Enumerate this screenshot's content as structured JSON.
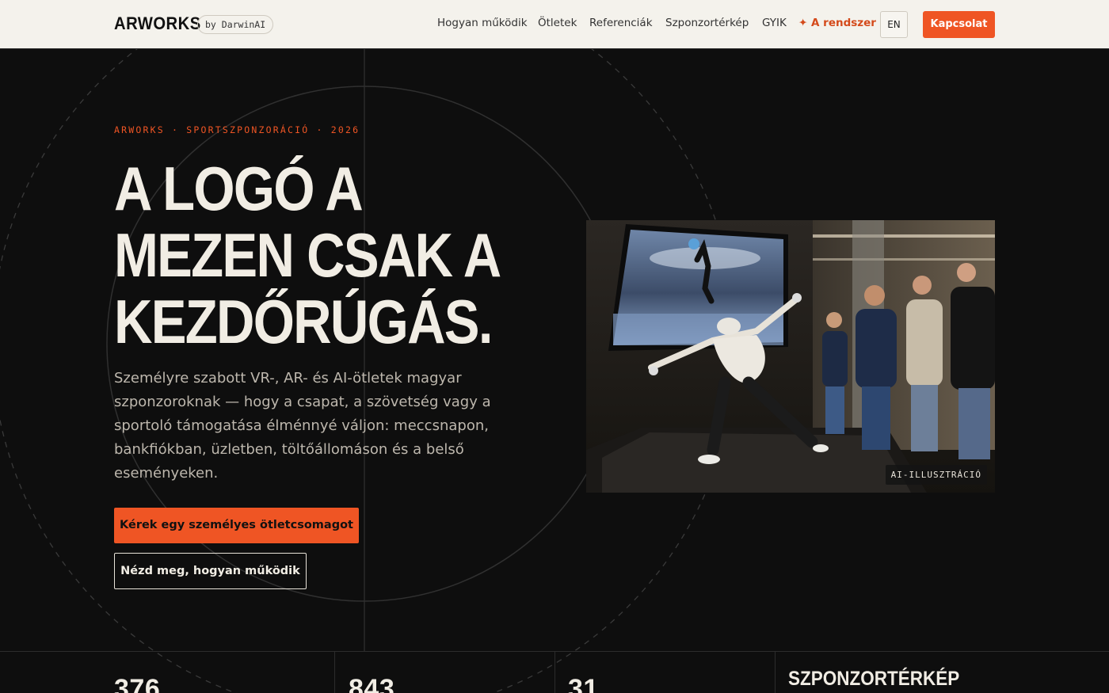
{
  "nav": {
    "brand": "ARWORKS",
    "brand_by": "by DarwinAI",
    "links": [
      {
        "label": "Hogyan működik"
      },
      {
        "label": "Ötletek"
      },
      {
        "label": "Referenciák"
      },
      {
        "label": "Szponzortérkép"
      },
      {
        "label": "GYIK"
      },
      {
        "label": "✦ A rendszer"
      }
    ],
    "lang": "EN",
    "contact": "Kapcsolat"
  },
  "hero": {
    "eyebrow": "ARWORKS · SPORTSZPONZORÁCIÓ · 2026",
    "headline_lines": [
      "A LOGÓ A",
      "MEZEN CSAK A",
      "KEZDŐRÚGÁS."
    ],
    "lead": "Személyre szabott VR-, AR- és AI-ötletek magyar szponzoroknak — hogy a csapat, a szövetség vagy a sportoló támogatása élménnyé váljon: meccsnapon, bankfiókban, üzletben, töltőállomáson és a belső eseményeken.",
    "cta_primary": "Kérek egy személyes ötletcsomagot",
    "cta_secondary": "Nézd meg, hogyan működik",
    "image_badge": "AI-ILLUSZTRÁCIÓ"
  },
  "stats": {
    "items": [
      {
        "value": "376"
      },
      {
        "value": "843"
      },
      {
        "value": "31"
      }
    ],
    "map_title": "SZPONZORTÉRKÉP"
  },
  "colors": {
    "accent": "#ef5524",
    "background": "#0e0e0e",
    "nav_background": "#f4f2ec",
    "headline": "#f1ede4"
  }
}
